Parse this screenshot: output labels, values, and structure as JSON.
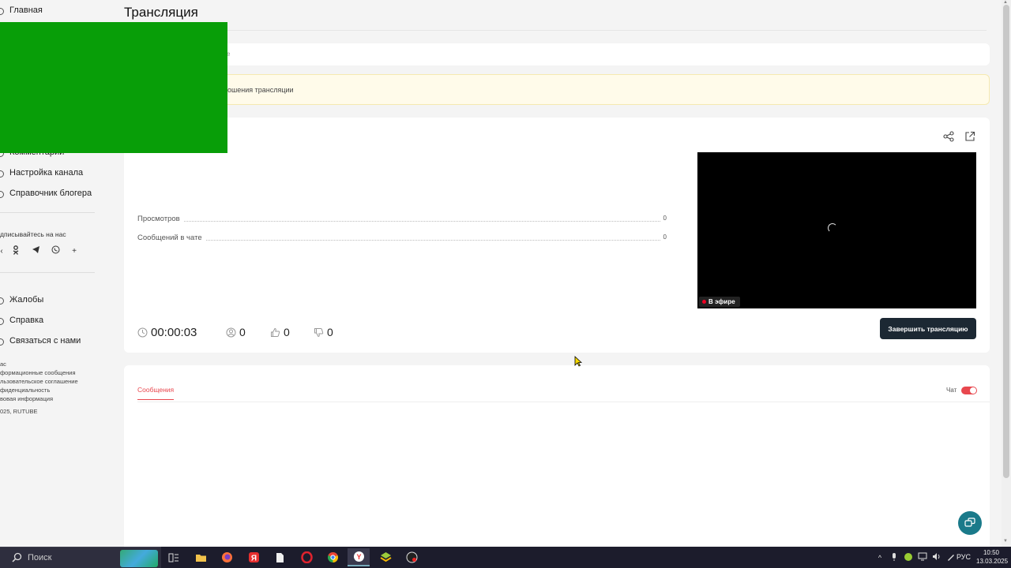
{
  "sidebar": {
    "home": "Главная",
    "comments": "Комментарии",
    "channel_settings": "Настройка канала",
    "blogger_guide": "Справочник блогера",
    "subscribe_heading": "дписывайтесь на нас",
    "complaints": "Жалобы",
    "help": "Справка",
    "contact": "Связаться с нами",
    "footer_links": [
      "ас",
      "формационные сообщения",
      "льзовательское соглашение",
      "фиденциальность",
      "вовая информация",
      "025, RUTUBE"
    ]
  },
  "page": {
    "title": "Трансляция",
    "crumb": "е",
    "warning": "ошения трансляции"
  },
  "stream": {
    "views_label": "Просмотров",
    "views_value": "0",
    "chat_messages_label": "Сообщений в чате",
    "chat_messages_value": "0",
    "timer": "00:00:03",
    "viewers": "0",
    "likes": "0",
    "dislikes": "0",
    "live_badge": "В эфире",
    "end_button": "Завершить трансляцию"
  },
  "chat": {
    "tab_messages": "Сообщения",
    "chat_toggle_label": "Чат",
    "chat_enabled": true
  },
  "taskbar": {
    "search_placeholder": "Поиск",
    "language": "РУС",
    "time": "10:50",
    "date": "13.03.2025"
  },
  "colors": {
    "accent": "#e8474e",
    "end_button_bg": "#1c2833",
    "green_overlay": "#089e08"
  }
}
